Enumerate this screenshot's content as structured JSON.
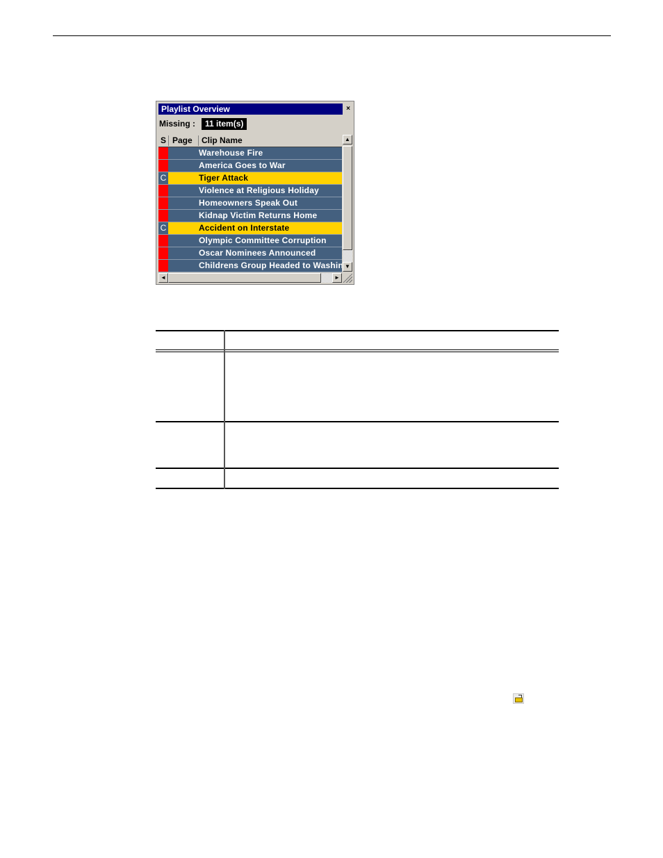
{
  "panel": {
    "title": "Playlist Overview",
    "close_glyph": "×",
    "missing_label": "Missing :",
    "missing_value": "11 item(s)",
    "columns": [
      "S",
      "Page",
      "Clip Name"
    ],
    "rows": [
      {
        "status": "",
        "page": "",
        "clip": "Warehouse Fire",
        "highlight": false
      },
      {
        "status": "",
        "page": "",
        "clip": "America Goes to War",
        "highlight": false
      },
      {
        "status": "C",
        "page": "",
        "clip": "Tiger Attack",
        "highlight": true
      },
      {
        "status": "",
        "page": "",
        "clip": "Violence at Religious Holiday",
        "highlight": false
      },
      {
        "status": "",
        "page": "",
        "clip": "Homeowners Speak Out",
        "highlight": false
      },
      {
        "status": "",
        "page": "",
        "clip": "Kidnap Victim Returns Home",
        "highlight": false
      },
      {
        "status": "C",
        "page": "",
        "clip": "Accident on Interstate",
        "highlight": true
      },
      {
        "status": "",
        "page": "",
        "clip": "Olympic Committee Corruption",
        "highlight": false
      },
      {
        "status": "",
        "page": "",
        "clip": "Oscar Nominees Announced",
        "highlight": false
      },
      {
        "status": "",
        "page": "",
        "clip": "Childrens Group Headed to Washin",
        "highlight": false
      }
    ],
    "colors": {
      "missing": "#ff0000",
      "row_bg": "#44607f",
      "highlight": "#ffd200",
      "title_bg": "#000080"
    }
  },
  "icons": {
    "scroll_up": "▲",
    "scroll_down": "▼",
    "scroll_left": "◄",
    "scroll_right": "►"
  }
}
